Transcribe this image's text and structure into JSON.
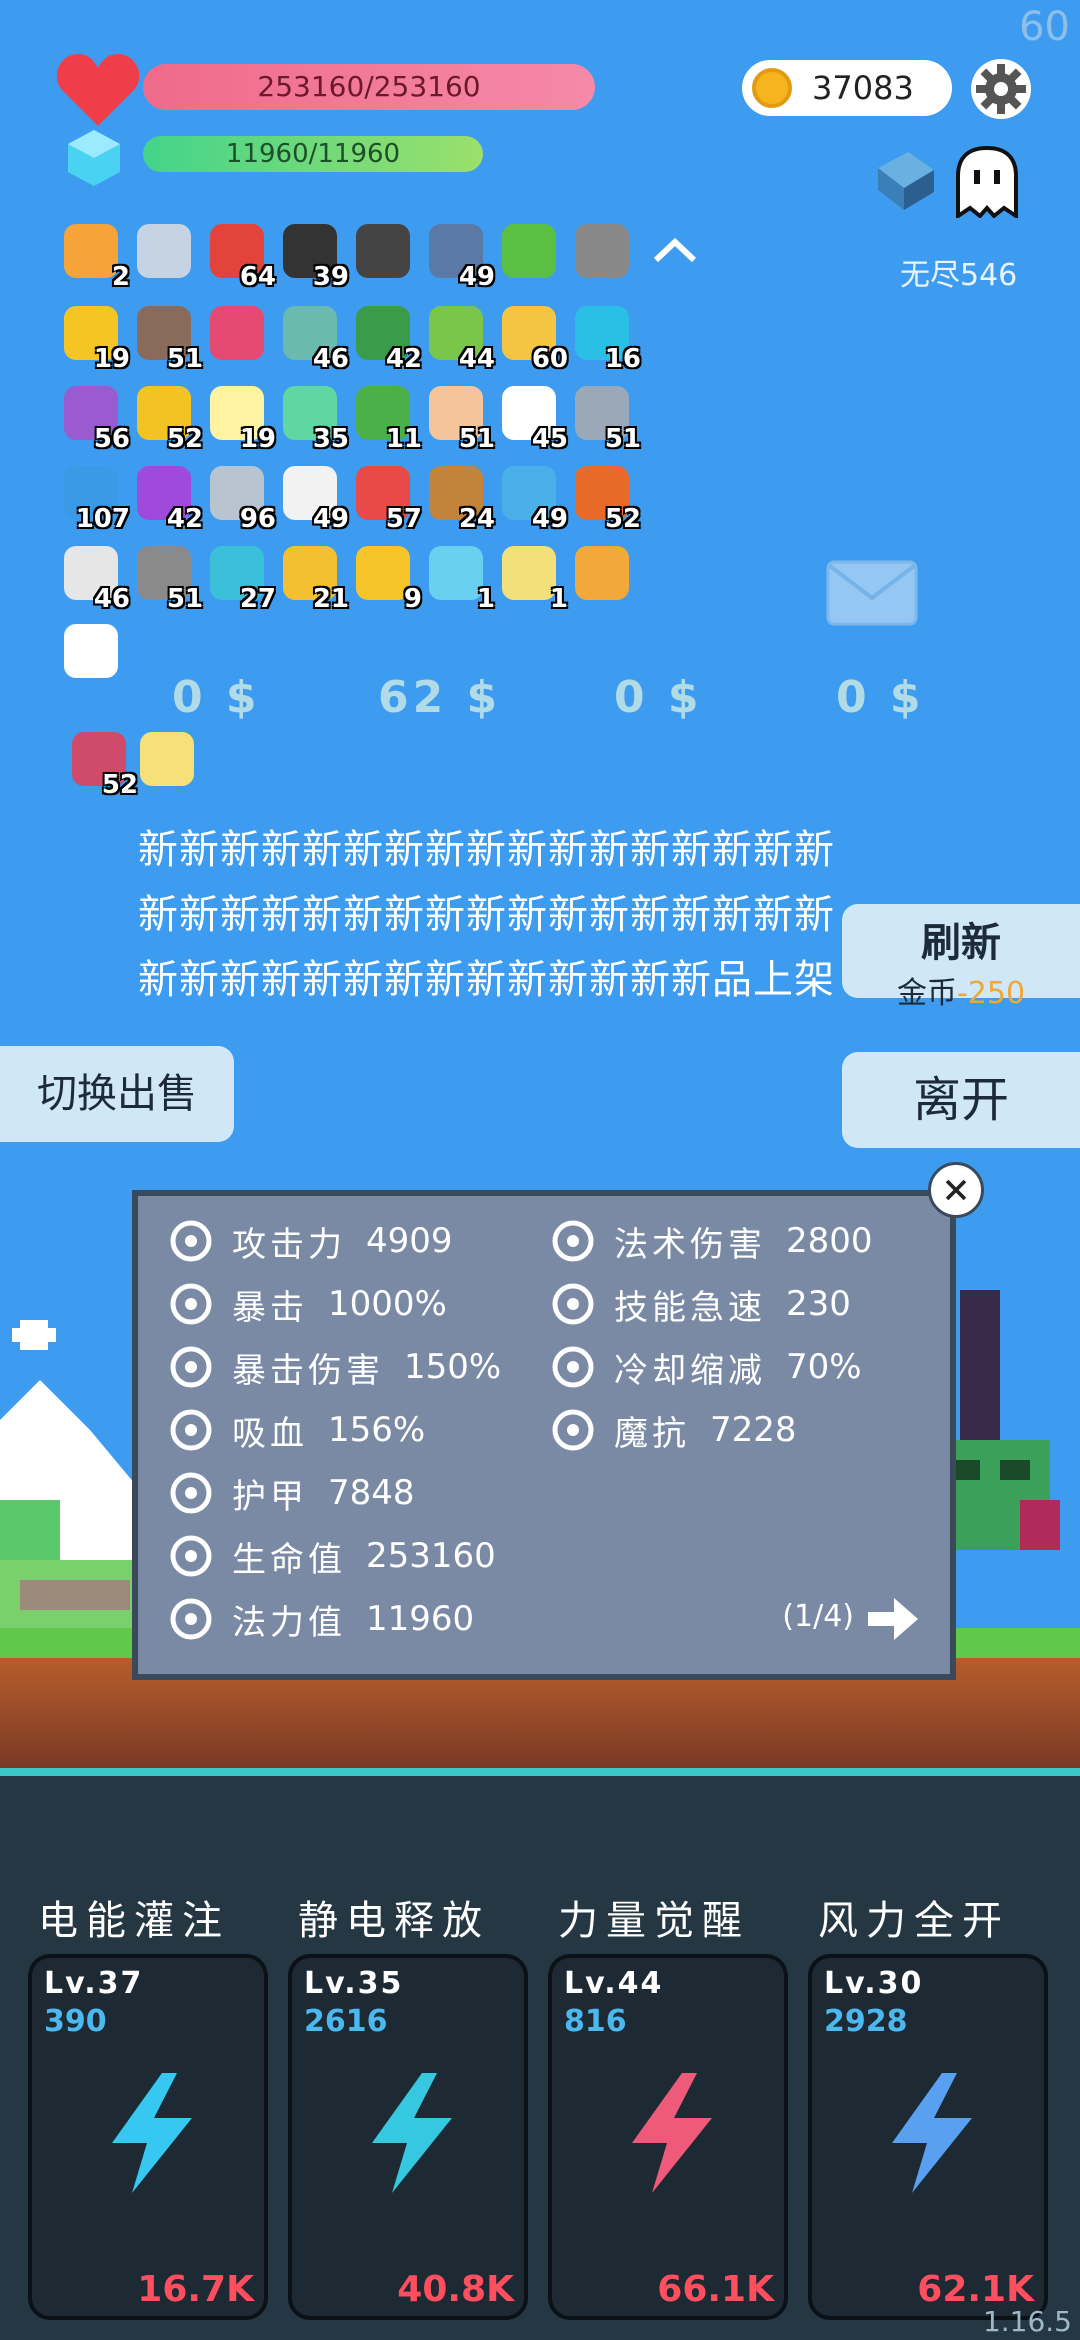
{
  "fps": "60",
  "version": "1.16.5",
  "player": {
    "hp": "253160/253160",
    "mp": "11960/11960"
  },
  "gold": "37083",
  "endless_label": "无尽546",
  "items": [
    {
      "icon": "scroll-icon",
      "count": "2",
      "color": "#f6a33a"
    },
    {
      "icon": "sword-icon",
      "count": "",
      "color": "#c5d3e2"
    },
    {
      "icon": "mushroom-icon",
      "count": "64",
      "color": "#e2443c"
    },
    {
      "icon": "bat-icon",
      "count": "39",
      "color": "#333"
    },
    {
      "icon": "book-icon",
      "count": "",
      "color": "#444"
    },
    {
      "icon": "shield-icon",
      "count": "49",
      "color": "#5a7aa5"
    },
    {
      "icon": "card-icon",
      "count": "",
      "color": "#5bbf44"
    },
    {
      "icon": "helmet-icon",
      "count": "",
      "color": "#888"
    },
    {
      "icon": "chevron-up-icon",
      "count": "",
      "color": "#fff"
    },
    {
      "icon": "wand-icon",
      "count": "19",
      "color": "#f5c623"
    },
    {
      "icon": "tombstone-icon",
      "count": "51",
      "color": "#8a6a5a"
    },
    {
      "icon": "love-letter-icon",
      "count": "",
      "color": "#e44a72"
    },
    {
      "icon": "ring-icon",
      "count": "46",
      "color": "#6abaad"
    },
    {
      "icon": "turtle-helmet-icon",
      "count": "42",
      "color": "#3a9b4a"
    },
    {
      "icon": "zombie-icon",
      "count": "44",
      "color": "#7ac64a"
    },
    {
      "icon": "pencil-icon",
      "count": "60",
      "color": "#f4c542"
    },
    {
      "icon": "crystal-icon",
      "count": "16",
      "color": "#2ac0e6"
    },
    {
      "icon": "star-shield-icon",
      "count": "56",
      "color": "#9a5ad0"
    },
    {
      "icon": "sunflower-icon",
      "count": "52",
      "color": "#f2c322"
    },
    {
      "icon": "bulb-icon",
      "count": "19",
      "color": "#fff2a0"
    },
    {
      "icon": "slime-icon",
      "count": "35",
      "color": "#5ed8a0"
    },
    {
      "icon": "money-heart-icon",
      "count": "11",
      "color": "#4ab04a"
    },
    {
      "icon": "fist-icon",
      "count": "51",
      "color": "#f4c49a"
    },
    {
      "icon": "ghost-item-icon",
      "count": "45",
      "color": "#fff"
    },
    {
      "icon": "axe-icon",
      "count": "51",
      "color": "#9aa8b8"
    },
    {
      "icon": "star-card-icon",
      "count": "107",
      "color": "#3a9ae6"
    },
    {
      "icon": "potion-icon",
      "count": "42",
      "color": "#a04adc"
    },
    {
      "icon": "greatsword-icon",
      "count": "96",
      "color": "#b8c4d0"
    },
    {
      "icon": "dice-icon",
      "count": "49",
      "color": "#f2f2f2"
    },
    {
      "icon": "gift-icon",
      "count": "57",
      "color": "#e84a4a"
    },
    {
      "icon": "bow-icon",
      "count": "24",
      "color": "#c2843a"
    },
    {
      "icon": "chat-icon",
      "count": "49",
      "color": "#4ab0e8"
    },
    {
      "icon": "meteor-icon",
      "count": "52",
      "color": "#e86a2a"
    },
    {
      "icon": "playing-card-icon",
      "count": "46",
      "color": "#e6e6e6"
    },
    {
      "icon": "spiked-ball-icon",
      "count": "51",
      "color": "#8a8a8a"
    },
    {
      "icon": "target-icon",
      "count": "27",
      "color": "#3ac0d8"
    },
    {
      "icon": "gold-ring-icon",
      "count": "21",
      "color": "#f4c032"
    },
    {
      "icon": "crown-icon",
      "count": "9",
      "color": "#f6c52a"
    },
    {
      "icon": "flask-icon",
      "count": "1",
      "color": "#6ad0f0"
    },
    {
      "icon": "halo-icon",
      "count": "1",
      "color": "#f4e07a"
    },
    {
      "icon": "tome-icon",
      "count": "",
      "color": "#f2a83a"
    },
    {
      "icon": "flower-icon",
      "count": "",
      "color": "#fff"
    }
  ],
  "items_row2": [
    {
      "icon": "striped-card-icon",
      "count": "52",
      "color": "#d04a6a"
    },
    {
      "icon": "idea-card-icon",
      "count": "",
      "color": "#f6e07a"
    }
  ],
  "shop_prices": [
    "0 $",
    "62 $",
    "0 $",
    "0 $"
  ],
  "new_text": "新新新新新新新新新新新新新新新新新新新新新新新新新新新新新新新新新新新新新新新新新新新新新新新新品上架",
  "refresh": {
    "label": "刷新",
    "cost_prefix": "金币",
    "cost": "-250"
  },
  "leave_label": "离开",
  "switch_label": "切换出售",
  "stats_left": [
    {
      "icon": "axe-stat-icon",
      "label": "攻击力",
      "value": "4909"
    },
    {
      "icon": "crit-icon",
      "label": "暴击",
      "value": "1000%"
    },
    {
      "icon": "crit-damage-icon",
      "label": "暴击伤害",
      "value": "150%"
    },
    {
      "icon": "lifesteal-icon",
      "label": "吸血",
      "value": "156%"
    },
    {
      "icon": "armor-icon",
      "label": "护甲",
      "value": "7848"
    },
    {
      "icon": "heart-stat-icon",
      "label": "生命值",
      "value": "253160"
    },
    {
      "icon": "mana-stat-icon",
      "label": "法力值",
      "value": "11960"
    }
  ],
  "stats_right": [
    {
      "icon": "magic-damage-icon",
      "label": "法术伤害",
      "value": "2800"
    },
    {
      "icon": "skill-haste-icon",
      "label": "技能急速",
      "value": "230"
    },
    {
      "icon": "cooldown-icon",
      "label": "冷却缩减",
      "value": "70%"
    },
    {
      "icon": "magic-resist-icon",
      "label": "魔抗",
      "value": "7228"
    }
  ],
  "stats_page": "(1/4)",
  "skills": [
    {
      "title": "电能灌注",
      "lv": "Lv.37",
      "cost": "390",
      "dmg": "16.7K",
      "icon": "lightning-skill-icon"
    },
    {
      "title": "静电释放",
      "lv": "Lv.35",
      "cost": "2616",
      "dmg": "40.8K",
      "icon": "arrows-skill-icon"
    },
    {
      "title": "力量觉醒",
      "lv": "Lv.44",
      "cost": "816",
      "dmg": "66.1K",
      "icon": "test-tube-skill-icon"
    },
    {
      "title": "风力全开",
      "lv": "Lv.30",
      "cost": "2928",
      "dmg": "62.1K",
      "icon": "feather-skill-icon"
    }
  ]
}
